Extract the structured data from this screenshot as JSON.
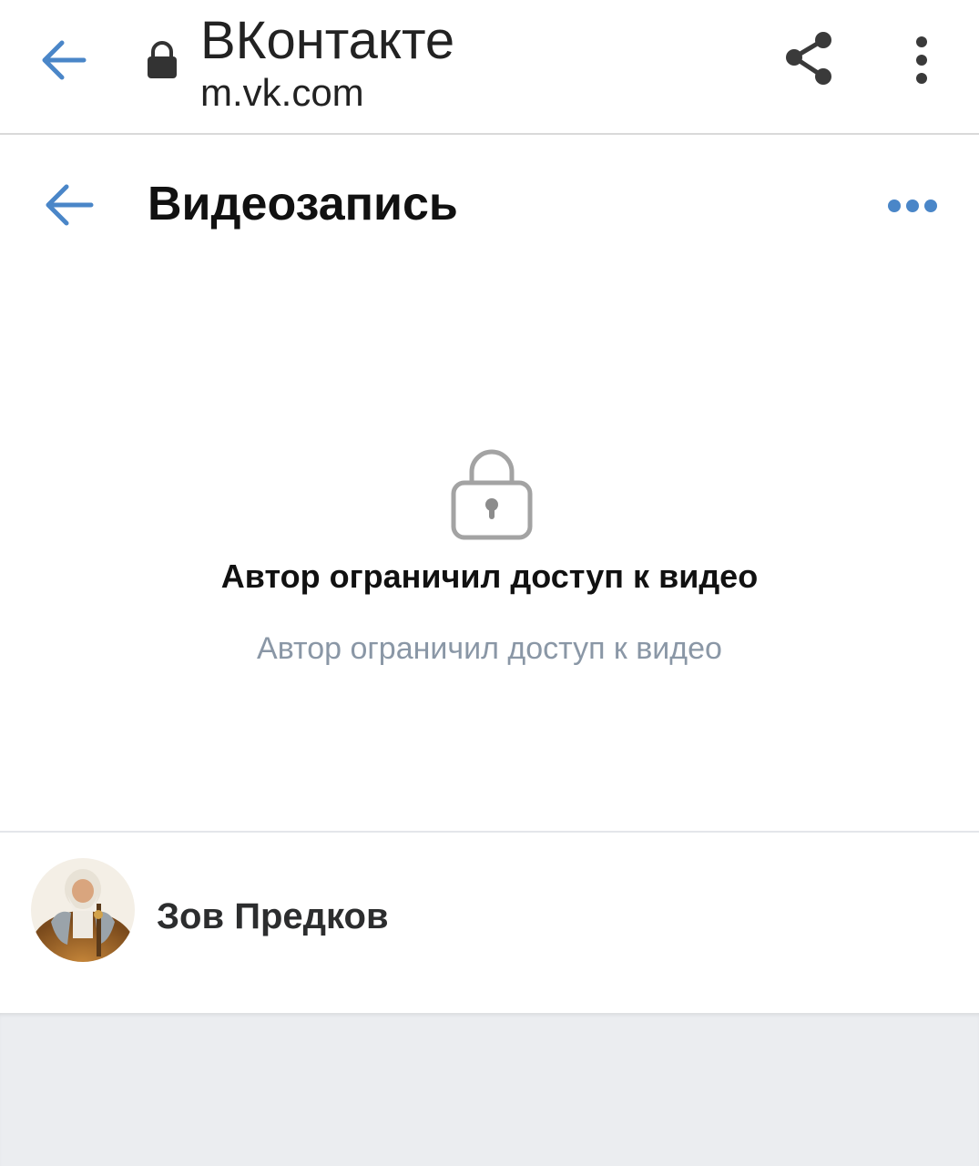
{
  "browser": {
    "site_title": "ВКонтакте",
    "url": "m.vk.com",
    "back_icon": "arrow-left-icon",
    "lock_icon": "lock-icon",
    "share_icon": "share-icon",
    "menu_icon": "more-vertical-icon"
  },
  "header": {
    "title": "Видеозапись",
    "back_icon": "arrow-left-icon",
    "more_icon": "more-horizontal-icon"
  },
  "locked": {
    "icon": "lock-icon",
    "title": "Автор ограничил доступ к видео",
    "subtitle": "Автор ограничил доступ к видео"
  },
  "owner": {
    "name": "Зов Предков"
  },
  "colors": {
    "accent": "#4a86c8",
    "icon_gray": "#4a4a4a",
    "muted_text": "#8a97a6",
    "page_bottom": "#ebedf0"
  }
}
